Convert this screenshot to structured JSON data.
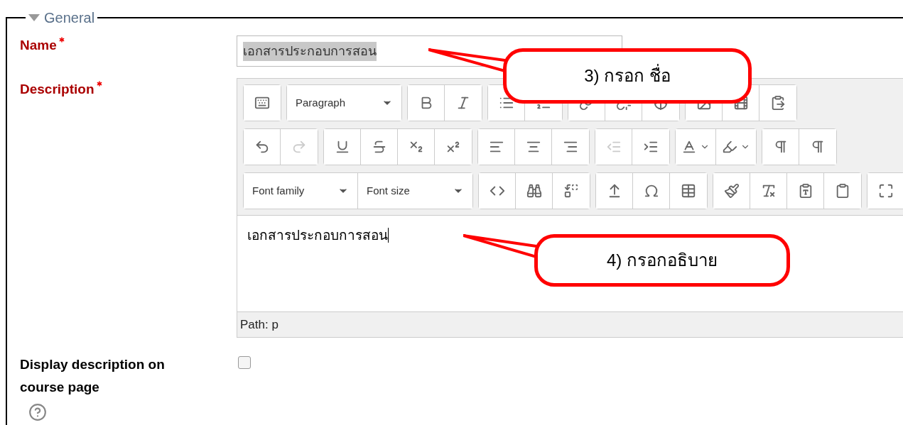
{
  "section": {
    "title": "General",
    "expanded": true
  },
  "name_field": {
    "label": "Name",
    "required": true,
    "value": "เอกสารประกอบการสอน",
    "value_selected": true
  },
  "description_field": {
    "label": "Description",
    "required": true,
    "toolbar_selects": [
      {
        "label": "Paragraph"
      },
      {
        "label": "Font family"
      },
      {
        "label": "Font size"
      }
    ],
    "content": "เอกสารประกอบการสอน",
    "path": "Path: p"
  },
  "display_option": {
    "label": "Display description on course page",
    "checked": false
  },
  "callouts": [
    {
      "text": "3)  กรอก ชื่อ"
    },
    {
      "text": "4)  กรอกอธิบาย"
    }
  ]
}
